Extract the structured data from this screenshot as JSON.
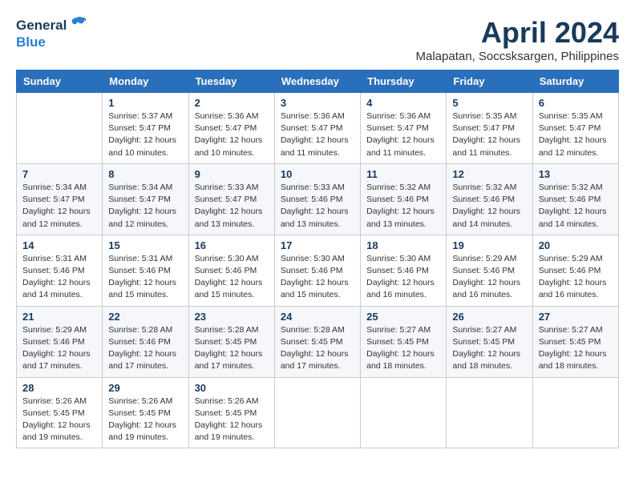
{
  "logo": {
    "general": "General",
    "blue": "Blue"
  },
  "title": {
    "month_year": "April 2024",
    "location": "Malapatan, Soccsksargen, Philippines"
  },
  "headers": [
    "Sunday",
    "Monday",
    "Tuesday",
    "Wednesday",
    "Thursday",
    "Friday",
    "Saturday"
  ],
  "weeks": [
    [
      {
        "day": "",
        "info": ""
      },
      {
        "day": "1",
        "info": "Sunrise: 5:37 AM\nSunset: 5:47 PM\nDaylight: 12 hours\nand 10 minutes."
      },
      {
        "day": "2",
        "info": "Sunrise: 5:36 AM\nSunset: 5:47 PM\nDaylight: 12 hours\nand 10 minutes."
      },
      {
        "day": "3",
        "info": "Sunrise: 5:36 AM\nSunset: 5:47 PM\nDaylight: 12 hours\nand 11 minutes."
      },
      {
        "day": "4",
        "info": "Sunrise: 5:36 AM\nSunset: 5:47 PM\nDaylight: 12 hours\nand 11 minutes."
      },
      {
        "day": "5",
        "info": "Sunrise: 5:35 AM\nSunset: 5:47 PM\nDaylight: 12 hours\nand 11 minutes."
      },
      {
        "day": "6",
        "info": "Sunrise: 5:35 AM\nSunset: 5:47 PM\nDaylight: 12 hours\nand 12 minutes."
      }
    ],
    [
      {
        "day": "7",
        "info": "Sunrise: 5:34 AM\nSunset: 5:47 PM\nDaylight: 12 hours\nand 12 minutes."
      },
      {
        "day": "8",
        "info": "Sunrise: 5:34 AM\nSunset: 5:47 PM\nDaylight: 12 hours\nand 12 minutes."
      },
      {
        "day": "9",
        "info": "Sunrise: 5:33 AM\nSunset: 5:47 PM\nDaylight: 12 hours\nand 13 minutes."
      },
      {
        "day": "10",
        "info": "Sunrise: 5:33 AM\nSunset: 5:46 PM\nDaylight: 12 hours\nand 13 minutes."
      },
      {
        "day": "11",
        "info": "Sunrise: 5:32 AM\nSunset: 5:46 PM\nDaylight: 12 hours\nand 13 minutes."
      },
      {
        "day": "12",
        "info": "Sunrise: 5:32 AM\nSunset: 5:46 PM\nDaylight: 12 hours\nand 14 minutes."
      },
      {
        "day": "13",
        "info": "Sunrise: 5:32 AM\nSunset: 5:46 PM\nDaylight: 12 hours\nand 14 minutes."
      }
    ],
    [
      {
        "day": "14",
        "info": "Sunrise: 5:31 AM\nSunset: 5:46 PM\nDaylight: 12 hours\nand 14 minutes."
      },
      {
        "day": "15",
        "info": "Sunrise: 5:31 AM\nSunset: 5:46 PM\nDaylight: 12 hours\nand 15 minutes."
      },
      {
        "day": "16",
        "info": "Sunrise: 5:30 AM\nSunset: 5:46 PM\nDaylight: 12 hours\nand 15 minutes."
      },
      {
        "day": "17",
        "info": "Sunrise: 5:30 AM\nSunset: 5:46 PM\nDaylight: 12 hours\nand 15 minutes."
      },
      {
        "day": "18",
        "info": "Sunrise: 5:30 AM\nSunset: 5:46 PM\nDaylight: 12 hours\nand 16 minutes."
      },
      {
        "day": "19",
        "info": "Sunrise: 5:29 AM\nSunset: 5:46 PM\nDaylight: 12 hours\nand 16 minutes."
      },
      {
        "day": "20",
        "info": "Sunrise: 5:29 AM\nSunset: 5:46 PM\nDaylight: 12 hours\nand 16 minutes."
      }
    ],
    [
      {
        "day": "21",
        "info": "Sunrise: 5:29 AM\nSunset: 5:46 PM\nDaylight: 12 hours\nand 17 minutes."
      },
      {
        "day": "22",
        "info": "Sunrise: 5:28 AM\nSunset: 5:46 PM\nDaylight: 12 hours\nand 17 minutes."
      },
      {
        "day": "23",
        "info": "Sunrise: 5:28 AM\nSunset: 5:45 PM\nDaylight: 12 hours\nand 17 minutes."
      },
      {
        "day": "24",
        "info": "Sunrise: 5:28 AM\nSunset: 5:45 PM\nDaylight: 12 hours\nand 17 minutes."
      },
      {
        "day": "25",
        "info": "Sunrise: 5:27 AM\nSunset: 5:45 PM\nDaylight: 12 hours\nand 18 minutes."
      },
      {
        "day": "26",
        "info": "Sunrise: 5:27 AM\nSunset: 5:45 PM\nDaylight: 12 hours\nand 18 minutes."
      },
      {
        "day": "27",
        "info": "Sunrise: 5:27 AM\nSunset: 5:45 PM\nDaylight: 12 hours\nand 18 minutes."
      }
    ],
    [
      {
        "day": "28",
        "info": "Sunrise: 5:26 AM\nSunset: 5:45 PM\nDaylight: 12 hours\nand 19 minutes."
      },
      {
        "day": "29",
        "info": "Sunrise: 5:26 AM\nSunset: 5:45 PM\nDaylight: 12 hours\nand 19 minutes."
      },
      {
        "day": "30",
        "info": "Sunrise: 5:26 AM\nSunset: 5:45 PM\nDaylight: 12 hours\nand 19 minutes."
      },
      {
        "day": "",
        "info": ""
      },
      {
        "day": "",
        "info": ""
      },
      {
        "day": "",
        "info": ""
      },
      {
        "day": "",
        "info": ""
      }
    ]
  ]
}
